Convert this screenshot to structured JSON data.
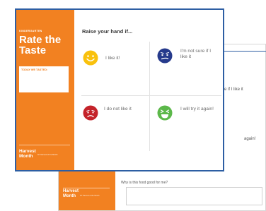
{
  "back_page": {
    "partial_not_sure": "re if I like it",
    "partial_try_again": "again!",
    "question": "Why is this food good for me?",
    "brand_line1": "Harvest",
    "brand_line2": "Month",
    "footer_small": "NY Harvest of the Month"
  },
  "front_sheet": {
    "kicker": "KINDERGARTEN",
    "title": "Rate the Taste",
    "today_label": "TODAY WE TASTED:",
    "brand_line1": "Harvest",
    "brand_line2": "Month",
    "footer_small": "NY Harvest of the Month",
    "heading": "Raise your hand if...",
    "choices": [
      {
        "label": "I like it!",
        "icon": "happy-face-icon",
        "color": "#f9c10d"
      },
      {
        "label": "I'm not sure if I like it",
        "icon": "unsure-face-icon",
        "color": "#263a8c"
      },
      {
        "label": "I do not like it",
        "icon": "sad-face-icon",
        "color": "#c4232a"
      },
      {
        "label": "I will try it again!",
        "icon": "laughing-face-icon",
        "color": "#5cb84a"
      }
    ]
  },
  "colors": {
    "orange": "#f28121",
    "border_blue": "#2d5ea3"
  }
}
